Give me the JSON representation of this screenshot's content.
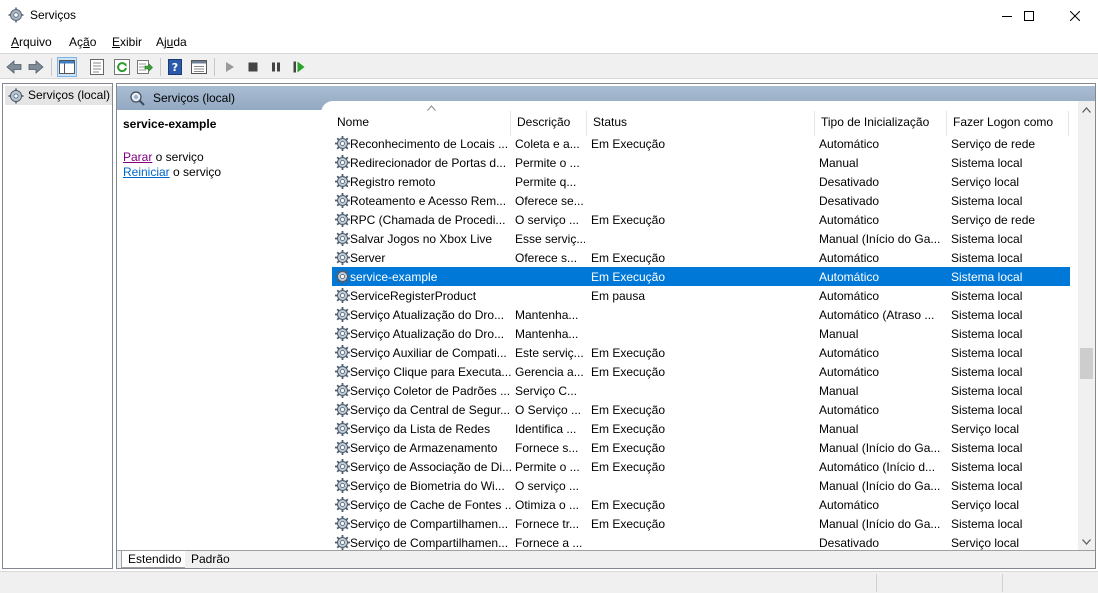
{
  "window": {
    "title": "Serviços"
  },
  "menu": {
    "items": [
      "Arquivo",
      "Ação",
      "Exibir",
      "Ajuda"
    ]
  },
  "tree": {
    "root_label": "Serviços (local)"
  },
  "banner": {
    "title": "Serviços (local)"
  },
  "details": {
    "service_name": "service-example",
    "stop_link": "Parar",
    "stop_suffix": " o serviço",
    "restart_link": "Reiniciar",
    "restart_suffix": " o serviço"
  },
  "columns": [
    "Nome",
    "Descrição",
    "Status",
    "Tipo de Inicialização",
    "Fazer Logon como"
  ],
  "rows": [
    [
      "Reconhecimento de Locais ...",
      "Coleta e a...",
      "Em Execução",
      "Automático",
      "Serviço de rede"
    ],
    [
      "Redirecionador de Portas d...",
      "Permite o ...",
      "",
      "Manual",
      "Sistema local"
    ],
    [
      "Registro remoto",
      "Permite q...",
      "",
      "Desativado",
      "Serviço local"
    ],
    [
      "Roteamento e Acesso Rem...",
      "Oferece se...",
      "",
      "Desativado",
      "Sistema local"
    ],
    [
      "RPC (Chamada de Procedi...",
      "O serviço ...",
      "Em Execução",
      "Automático",
      "Serviço de rede"
    ],
    [
      "Salvar Jogos no Xbox Live",
      "Esse serviç...",
      "",
      "Manual (Início do Ga...",
      "Sistema local"
    ],
    [
      "Server",
      "Oferece s...",
      "Em Execução",
      "Automático",
      "Sistema local"
    ],
    [
      "service-example",
      "",
      "Em Execução",
      "Automático",
      "Sistema local"
    ],
    [
      "ServiceRegisterProduct",
      "",
      "Em pausa",
      "Automático",
      "Sistema local"
    ],
    [
      "Serviço Atualização do Dro...",
      "Mantenha...",
      "",
      "Automático (Atraso ...",
      "Sistema local"
    ],
    [
      "Serviço Atualização do Dro...",
      "Mantenha...",
      "",
      "Manual",
      "Sistema local"
    ],
    [
      "Serviço Auxiliar de Compati...",
      "Este serviç...",
      "Em Execução",
      "Automático",
      "Sistema local"
    ],
    [
      "Serviço Clique para Executa...",
      "Gerencia a...",
      "Em Execução",
      "Automático",
      "Sistema local"
    ],
    [
      "Serviço Coletor de Padrões ...",
      "Serviço C...",
      "",
      "Manual",
      "Sistema local"
    ],
    [
      "Serviço da Central de Segur...",
      "O Serviço ...",
      "Em Execução",
      "Automático",
      "Sistema local"
    ],
    [
      "Serviço da Lista de Redes",
      "Identifica ...",
      "Em Execução",
      "Manual",
      "Serviço local"
    ],
    [
      "Serviço de Armazenamento",
      "Fornece s...",
      "Em Execução",
      "Manual (Início do Ga...",
      "Sistema local"
    ],
    [
      "Serviço de Associação de Di...",
      "Permite o ...",
      "Em Execução",
      "Automático (Início d...",
      "Sistema local"
    ],
    [
      "Serviço de Biometria do Wi...",
      "O serviço ...",
      "",
      "Manual (Início do Ga...",
      "Sistema local"
    ],
    [
      "Serviço de Cache de Fontes ...",
      "Otimiza o ...",
      "Em Execução",
      "Automático",
      "Serviço local"
    ],
    [
      "Serviço de Compartilhamen...",
      "Fornece tr...",
      "Em Execução",
      "Manual (Início do Ga...",
      "Sistema local"
    ],
    [
      "Serviço de Compartilhamen...",
      "Fornece a ...",
      "",
      "Desativado",
      "Serviço local"
    ]
  ],
  "tabs": [
    "Estendido",
    "Padrão"
  ]
}
